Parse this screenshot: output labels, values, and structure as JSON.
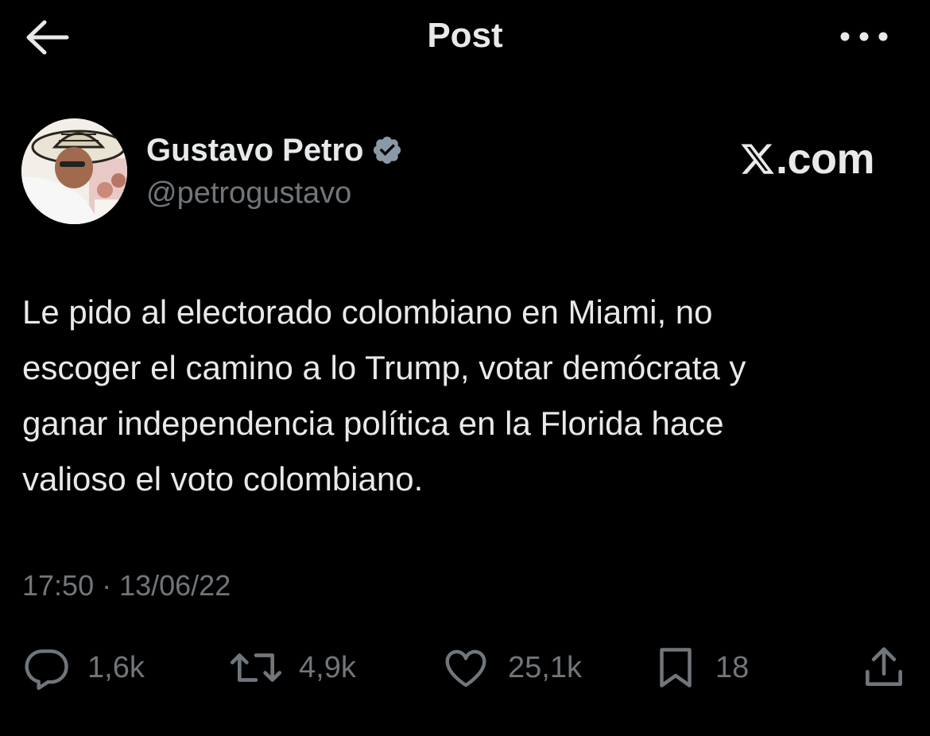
{
  "header": {
    "title": "Post",
    "back_icon": "arrow-left-icon",
    "more_icon": "more-horizontal-icon"
  },
  "author": {
    "name": "Gustavo Petro",
    "handle": "@petrogustavo",
    "verified": true,
    "verified_badge_color": "#8b98a5"
  },
  "watermark": {
    "text": ".com"
  },
  "post": {
    "lines": [
      "Le pido al electorado colombiano en Miami, no",
      "escoger el camino a lo Trump, votar demócrata y",
      "ganar independencia política en la Florida hace",
      "valioso el voto colombiano."
    ],
    "timestamp": "17:50 · 13/06/22"
  },
  "actions": {
    "replies": {
      "icon": "reply-icon",
      "count": "1,6k"
    },
    "reposts": {
      "icon": "repost-icon",
      "count": "4,9k"
    },
    "likes": {
      "icon": "heart-icon",
      "count": "25,1k"
    },
    "bookmarks": {
      "icon": "bookmark-icon",
      "count": "18"
    },
    "share": {
      "icon": "share-icon"
    }
  },
  "colors": {
    "background": "#000000",
    "text_primary": "#e7e9ea",
    "text_secondary": "#71767b"
  }
}
